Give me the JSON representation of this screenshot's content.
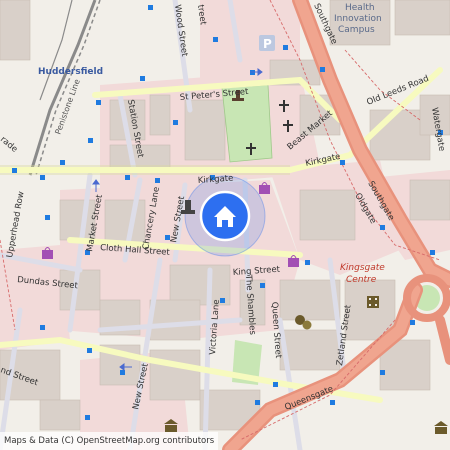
{
  "map": {
    "attribution": "Maps & Data (C) OpenStreetMap.org contributors",
    "colors": {
      "background": "#f2efe9",
      "commercial": "#f2dad9",
      "building": "#d9d0c9",
      "primary_road": "#e8927c",
      "secondary_road": "#f7fabf",
      "pedestrian": "#dddde8",
      "park": "#c8e6b4",
      "bus_stop": "#1f7be0",
      "location_marker": "#2d6ff0",
      "railway": "#8a8a8a"
    },
    "labels": {
      "huddersfield": "Huddersfield",
      "station_street": "Station Street",
      "st_peters_street": "St Peter's Street",
      "wood_street": "Wood Street",
      "kirkgate_west": "Kirkgate",
      "kirkgate_east": "Kirkgate",
      "beast_market": "Beast Market",
      "old_leeds_road": "Old Leeds Road",
      "watergate": "Watergate",
      "southgate_north": "Southgate",
      "southgate_south": "Southgate",
      "oldgate": "Oldgate",
      "market_street": "Market Street",
      "chancery_lane": "Chancery Lane",
      "new_street_north": "New Street",
      "new_street_south": "New Street",
      "cloth_hall_street": "Cloth Hall Street",
      "upperhead_row": "Upperhead Row",
      "dundas_street": "Dundas Street",
      "king_street": "King Street",
      "kingsgate_centre": "Kingsgate\nCentre",
      "the_shambles": "The Shambles",
      "victoria_lane": "Victoria Lane",
      "queen_street": "Queen Street",
      "zetland_street": "Zetland Street",
      "queensgate": "Queensgate",
      "health_innovation_campus": "Health\nInnovation\nCampus",
      "penistone_line": "Penistone Line",
      "grade": "rade",
      "street_fragment": "treet",
      "nd_street": "nd Street"
    },
    "icons": [
      "location-marker-icon",
      "parking-icon",
      "church-icon",
      "shopping-bag-icon",
      "theatre-icon",
      "cinema-icon",
      "monument-icon",
      "museum-icon",
      "bus-stop-icon",
      "one-way-arrow-icon"
    ]
  }
}
